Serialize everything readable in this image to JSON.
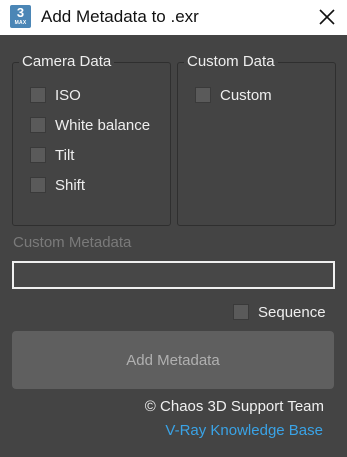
{
  "window": {
    "title": "Add Metadata to .exr",
    "app_icon": {
      "number": "3",
      "label": "MAX"
    }
  },
  "camera_data": {
    "title": "Camera Data",
    "items": [
      {
        "label": "ISO",
        "checked": false
      },
      {
        "label": "White balance",
        "checked": false
      },
      {
        "label": "Tilt",
        "checked": false
      },
      {
        "label": "Shift",
        "checked": false
      }
    ]
  },
  "custom_data": {
    "title": "Custom Data",
    "items": [
      {
        "label": "Custom",
        "checked": false
      }
    ]
  },
  "custom_metadata": {
    "label": "Custom Metadata",
    "value": ""
  },
  "sequence": {
    "label": "Sequence",
    "checked": false
  },
  "add_button": {
    "label": "Add Metadata"
  },
  "footer": {
    "credit": "© Chaos 3D Support Team",
    "link": "V-Ray Knowledge Base"
  },
  "colors": {
    "background": "#444444",
    "link": "#3aa3e6",
    "disabled_text": "#7a7a7a"
  }
}
